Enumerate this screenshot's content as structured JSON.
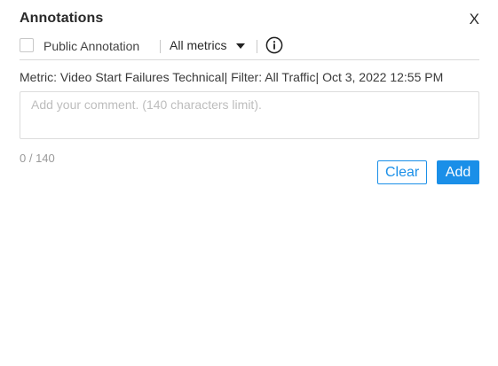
{
  "dialog": {
    "title": "Annotations",
    "close_label": "X"
  },
  "toolbar": {
    "public_checkbox_checked": false,
    "public_label": "Public Annotation",
    "metric_select_value": "All metrics",
    "info_icon": "info-circle-icon"
  },
  "meta": {
    "line": "Metric: Video Start Failures Technical| Filter: All Traffic| Oct 3, 2022 12:55 PM"
  },
  "comment": {
    "value": "",
    "placeholder": "Add your comment. (140 characters limit)."
  },
  "counter": "0 / 140",
  "actions": {
    "clear_label": "Clear",
    "add_label": "Add"
  },
  "colors": {
    "accent": "#1a8fe8",
    "border": "#dcdcdc",
    "text": "#333333",
    "placeholder": "#bdbdbd"
  }
}
